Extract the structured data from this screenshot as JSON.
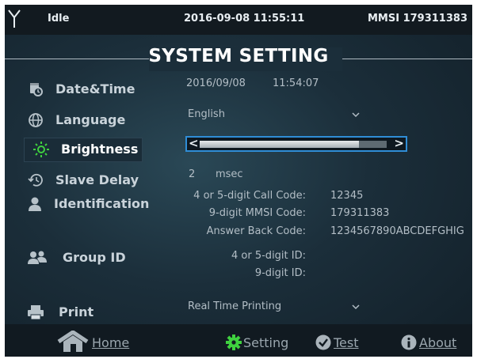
{
  "status": {
    "state": "Idle",
    "datetime": "2016-09-08 11:55:11",
    "mmsi": "MMSI 179311383"
  },
  "title": "SYSTEM SETTING",
  "menu": [
    {
      "label": "Date&Time",
      "icon": "calendar-clock-icon"
    },
    {
      "label": "Language",
      "icon": "globe-icon"
    },
    {
      "label": "Brightness",
      "icon": "sun-icon"
    },
    {
      "label": "Slave Delay",
      "icon": "history-icon"
    },
    {
      "label": "Identification",
      "icon": "person-icon"
    },
    {
      "label": "Group ID",
      "icon": "group-icon"
    },
    {
      "label": "Print",
      "icon": "printer-icon"
    }
  ],
  "datetime_setting": {
    "date": "2016/09/08",
    "time": "11:54:07"
  },
  "language": {
    "value": "English"
  },
  "brightness": {
    "level": 0.85
  },
  "slave_delay": {
    "value": "2",
    "unit": "msec"
  },
  "identification": {
    "call_code_label": "4 or 5-digit Call Code:",
    "call_code": "12345",
    "mmsi_code_label": "9-digit MMSI Code:",
    "mmsi_code": "179311383",
    "answer_back_label": "Answer Back Code:",
    "answer_back": "1234567890ABCDEFGHIG"
  },
  "group_id": {
    "short_label": "4 or 5-digit ID:",
    "long_label": "9-digit ID:"
  },
  "print": {
    "value": "Real Time Printing"
  },
  "nav": {
    "home": "Home",
    "setting": "Setting",
    "test": "Test",
    "about": "About"
  },
  "colors": {
    "accent_blue": "#2f8dd6",
    "active_green": "#3fd13f"
  }
}
